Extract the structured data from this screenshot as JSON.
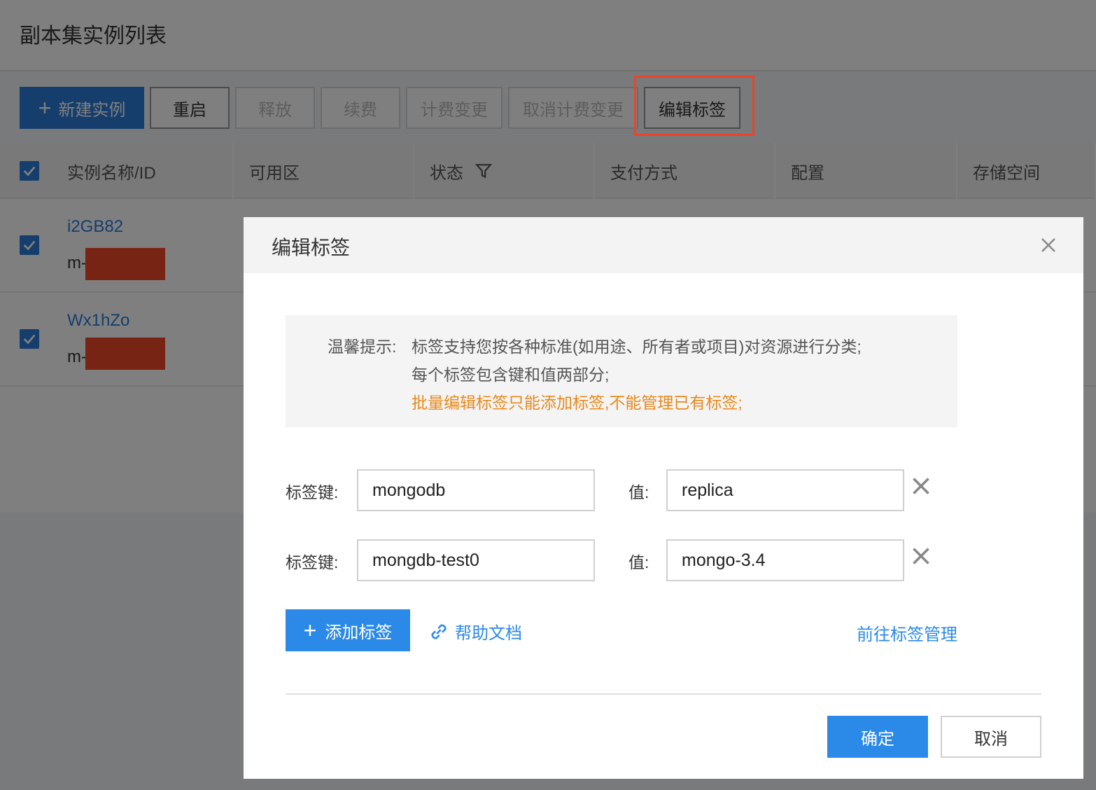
{
  "page": {
    "title": "副本集实例列表"
  },
  "toolbar": {
    "new_label": "新建实例",
    "restart_label": "重启",
    "release_label": "释放",
    "renew_label": "续费",
    "billing_change_label": "计费变更",
    "cancel_billing_change_label": "取消计费变更",
    "edit_tags_label": "编辑标签"
  },
  "table": {
    "headers": [
      "实例名称/ID",
      "可用区",
      "状态",
      "支付方式",
      "配置",
      "存储空间"
    ],
    "rows": [
      {
        "name": "i2GB82",
        "id_prefix": "m-",
        "checked": true
      },
      {
        "name": "Wx1hZo",
        "id_prefix": "m-",
        "checked": true
      }
    ]
  },
  "dialog": {
    "title": "编辑标签",
    "tip": {
      "label": "温馨提示:",
      "line1": "标签支持您按各种标准(如用途、所有者或项目)对资源进行分类;",
      "line2": "每个标签包含键和值两部分;",
      "line3": "批量编辑标签只能添加标签,不能管理已有标签;"
    },
    "key_label": "标签键:",
    "value_label": "值:",
    "tags": [
      {
        "key": "mongodb",
        "value": "replica"
      },
      {
        "key": "mongdb-test0",
        "value": "mongo-3.4"
      }
    ],
    "add_tag_label": "添加标签",
    "help_doc_label": "帮助文档",
    "manage_link_label": "前往标签管理",
    "ok_label": "确定",
    "cancel_label": "取消"
  },
  "colors": {
    "primary": "#2b8ae8",
    "toolbar_primary": "#2b7cd9",
    "warning_text": "#e8891c",
    "highlight_box": "#e8452a",
    "redaction": "#f0492a"
  }
}
